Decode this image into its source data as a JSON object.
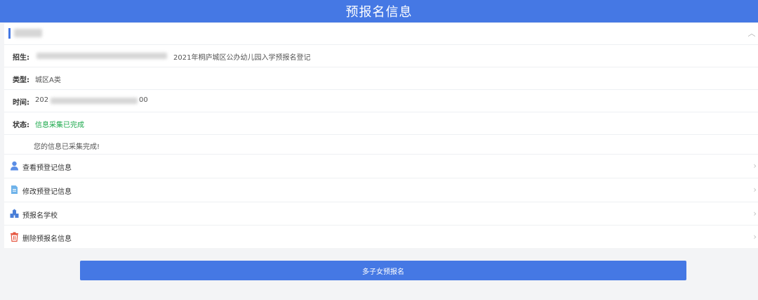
{
  "header": {
    "title": "预报名信息"
  },
  "card": {
    "fields": [
      {
        "label": "招生:",
        "value": "2021年桐庐城区公办幼儿园入学预报名登记"
      },
      {
        "label": "类型:",
        "value": "城区A类"
      },
      {
        "label": "时间:",
        "value_prefix": "202",
        "value_suffix": "00"
      },
      {
        "label": "状态:",
        "value": "信息采集已完成"
      }
    ],
    "note": "您的信息已采集完成!"
  },
  "menu": [
    {
      "label": "查看预登记信息",
      "icon": "user-icon"
    },
    {
      "label": "修改预登记信息",
      "icon": "document-edit-icon"
    },
    {
      "label": "预报名学校",
      "icon": "school-icon"
    },
    {
      "label": "删除预报名信息",
      "icon": "trash-icon"
    }
  ],
  "colors": {
    "primary": "#4578e4",
    "status_green": "#1aa84a",
    "danger": "#e5533d"
  },
  "actions": {
    "multi_child_label": "多子女预报名"
  }
}
